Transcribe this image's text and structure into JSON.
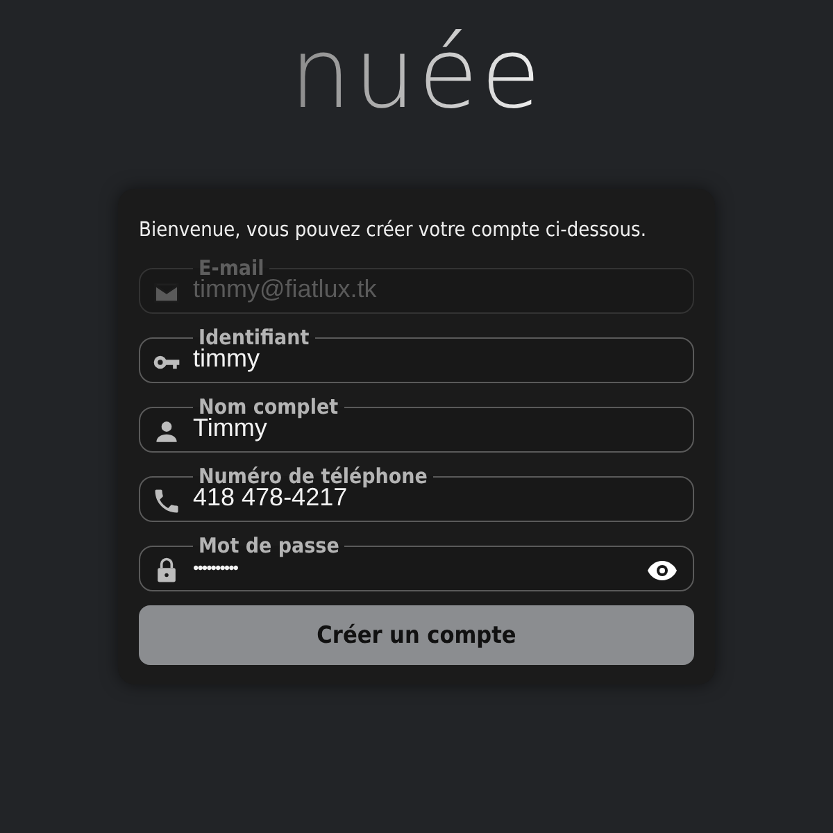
{
  "logo": "nuée",
  "intro": "Bienvenue, vous pouvez créer votre compte ci-dessous.",
  "fields": [
    {
      "kind": "email",
      "label": "E-mail",
      "value": "timmy@fiatlux.tk",
      "disabled": true
    },
    {
      "kind": "username",
      "label": "Identifiant",
      "value": "timmy",
      "disabled": false
    },
    {
      "kind": "name",
      "label": "Nom complet",
      "value": "Timmy",
      "disabled": false
    },
    {
      "kind": "phone",
      "label": "Numéro de téléphone",
      "value": "418 478-4217",
      "disabled": false
    },
    {
      "kind": "password",
      "label": "Mot de passe",
      "value": "••••••••••",
      "disabled": false
    }
  ],
  "submit": "Créer un compte"
}
